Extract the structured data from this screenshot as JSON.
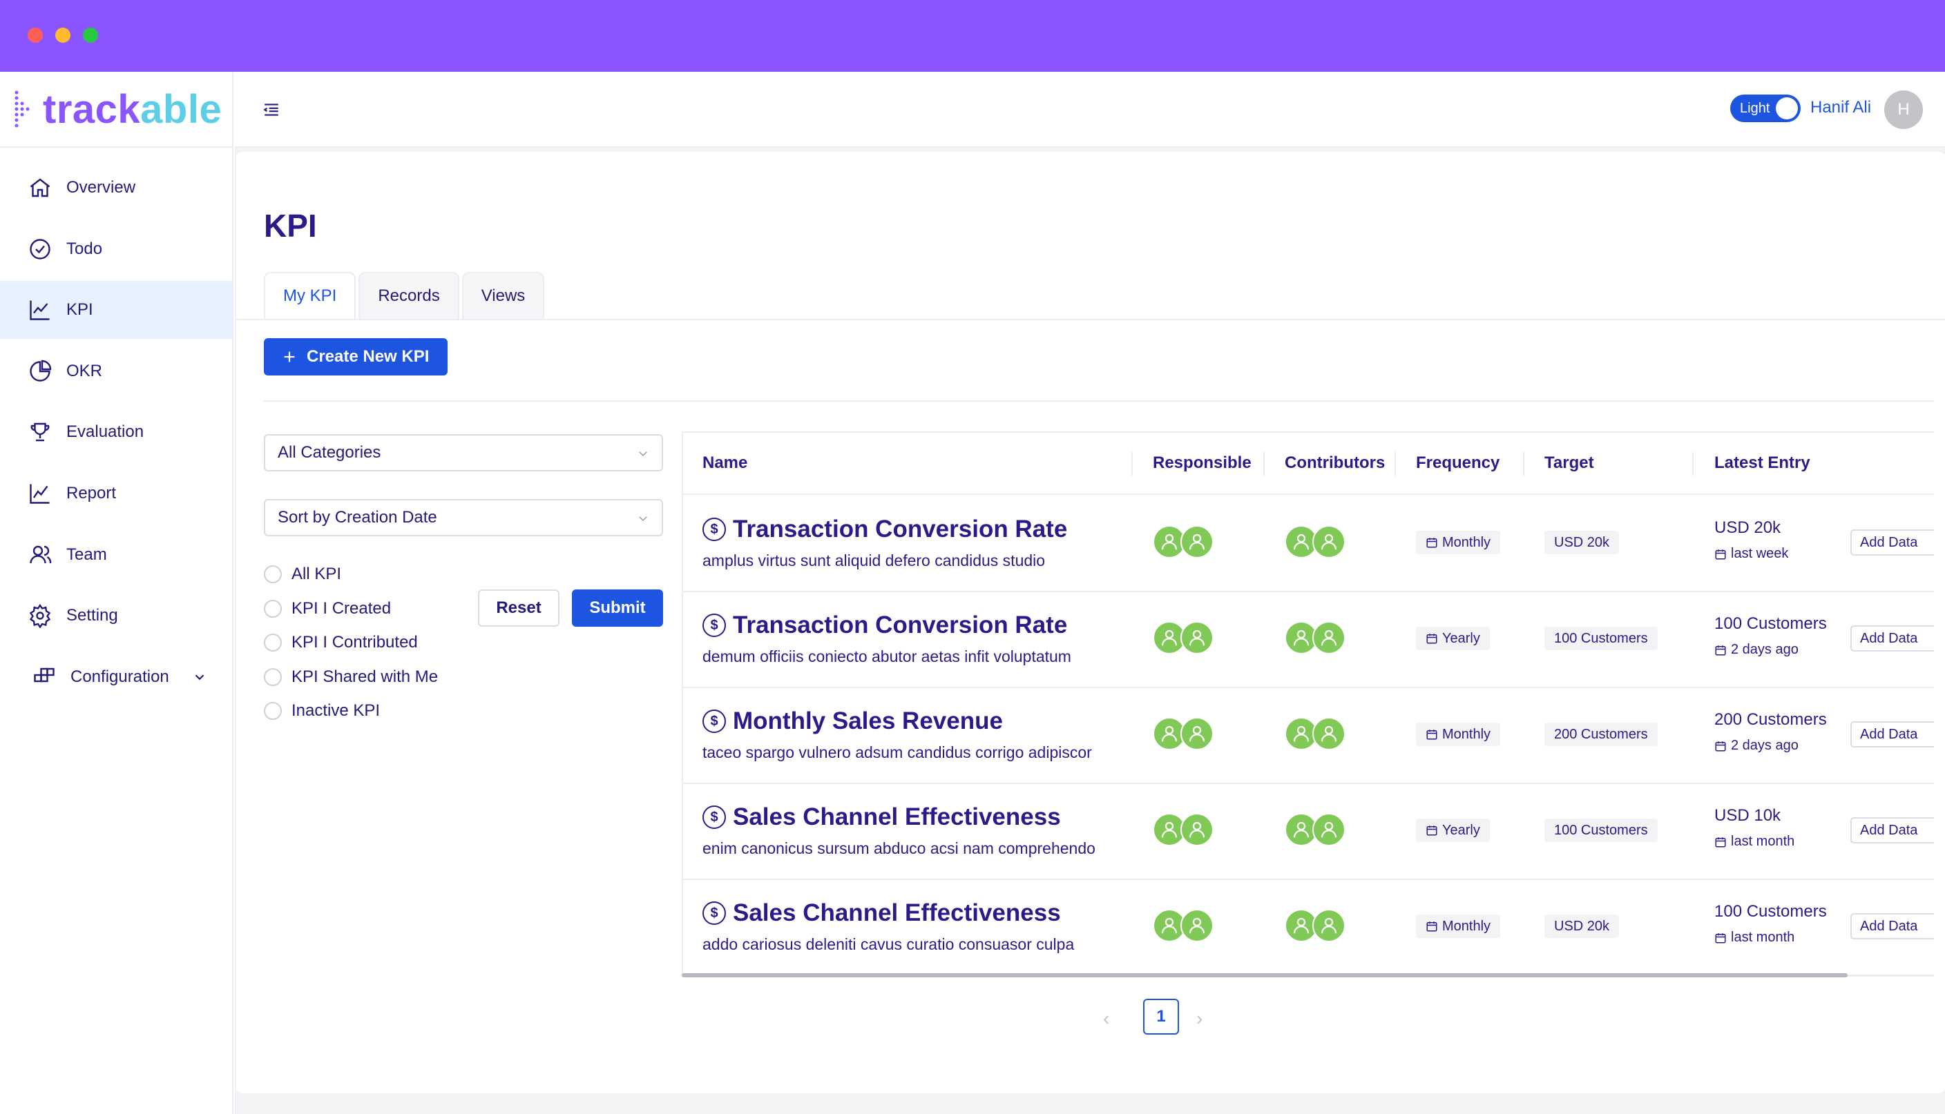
{
  "brand": {
    "logo_main": "track",
    "logo_accent": "able",
    "primary": "#8a55ff",
    "accent": "#5ccfe6",
    "link_blue": "#1d55e0",
    "avatar_green": "#80c957"
  },
  "sidebar": {
    "items": [
      {
        "label": "Overview",
        "icon": "home-icon"
      },
      {
        "label": "Todo",
        "icon": "check-circle-icon"
      },
      {
        "label": "KPI",
        "icon": "line-chart-icon",
        "active": true
      },
      {
        "label": "OKR",
        "icon": "pie-chart-icon"
      },
      {
        "label": "Evaluation",
        "icon": "trophy-icon"
      },
      {
        "label": "Report",
        "icon": "line-chart-icon"
      },
      {
        "label": "Team",
        "icon": "users-icon"
      },
      {
        "label": "Setting",
        "icon": "gear-icon"
      },
      {
        "label": "Configuration",
        "icon": "grid-icon",
        "has_submenu": true
      }
    ]
  },
  "topbar": {
    "theme_label": "Light",
    "user_name": "Hanif Ali",
    "avatar_initial": "H"
  },
  "page": {
    "title": "KPI"
  },
  "tabs": [
    {
      "label": "My KPI",
      "active": true
    },
    {
      "label": "Records"
    },
    {
      "label": "Views"
    }
  ],
  "create_button": "Create New KPI",
  "filters": {
    "category": "All Categories",
    "sort": "Sort by Creation Date",
    "options": [
      "All KPI",
      "KPI I Created",
      "KPI I Contributed",
      "KPI Shared with Me",
      "Inactive KPI"
    ],
    "reset_label": "Reset",
    "submit_label": "Submit"
  },
  "table": {
    "headers": {
      "name": "Name",
      "responsible": "Responsible",
      "contributors": "Contributors",
      "frequency": "Frequency",
      "target": "Target",
      "latest": "Latest Entry"
    },
    "add_label": "Add Data",
    "rows": [
      {
        "name": "Transaction Conversion Rate",
        "desc": "amplus virtus sunt aliquid defero candidus studio",
        "frequency": "Monthly",
        "target": "USD 20k",
        "latest_value": "USD 20k",
        "latest_when": "last week"
      },
      {
        "name": "Transaction Conversion Rate",
        "desc": "demum officiis coniecto abutor aetas infit voluptatum",
        "frequency": "Yearly",
        "target": "100 Customers",
        "latest_value": "100 Customers",
        "latest_when": "2 days ago"
      },
      {
        "name": "Monthly Sales Revenue",
        "desc": "taceo spargo vulnero adsum candidus corrigo adipiscor",
        "frequency": "Monthly",
        "target": "200 Customers",
        "latest_value": "200 Customers",
        "latest_when": "2 days ago"
      },
      {
        "name": "Sales Channel Effectiveness",
        "desc": "enim canonicus sursum abduco acsi nam comprehendo",
        "frequency": "Yearly",
        "target": "100 Customers",
        "latest_value": "USD 10k",
        "latest_when": "last month"
      },
      {
        "name": "Sales Channel Effectiveness",
        "desc": "addo cariosus deleniti cavus curatio consuasor culpa",
        "frequency": "Monthly",
        "target": "USD 20k",
        "latest_value": "100 Customers",
        "latest_when": "last month"
      }
    ]
  },
  "pagination": {
    "current": "1",
    "prev": "‹",
    "next": "›"
  }
}
